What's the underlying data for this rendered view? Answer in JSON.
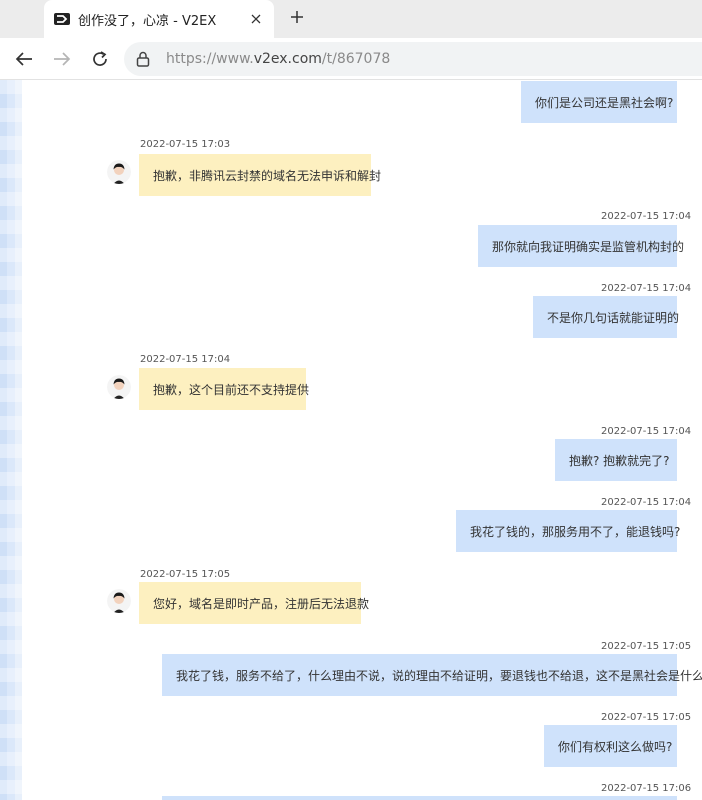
{
  "browser": {
    "tab_title": "创作没了，心凉 - V2EX",
    "url_prefix": "https://www.",
    "url_domain": "v2ex.com",
    "url_path": "/t/867078"
  },
  "chat": {
    "colors": {
      "user_bubble": "#cfe2fb",
      "service_bubble": "#fdf0c0"
    },
    "messages": [
      {
        "side": "right",
        "time": "",
        "text": "你们是公司还是黑社会啊?"
      },
      {
        "side": "left",
        "time": "2022-07-15 17:03",
        "text": "抱歉，非腾讯云封禁的域名无法申诉和解封"
      },
      {
        "side": "right",
        "time": "2022-07-15 17:04",
        "text": "那你就向我证明确实是监管机构封的"
      },
      {
        "side": "right",
        "time": "2022-07-15 17:04",
        "text": "不是你几句话就能证明的"
      },
      {
        "side": "left",
        "time": "2022-07-15 17:04",
        "text": "抱歉，这个目前还不支持提供"
      },
      {
        "side": "right",
        "time": "2022-07-15 17:04",
        "text": "抱歉? 抱歉就完了?"
      },
      {
        "side": "right",
        "time": "2022-07-15 17:04",
        "text": "我花了钱的，那服务用不了，能退钱吗?"
      },
      {
        "side": "left",
        "time": "2022-07-15 17:05",
        "text": "您好，域名是即时产品，注册后无法退款"
      },
      {
        "side": "right",
        "time": "2022-07-15 17:05",
        "text": "我花了钱，服务不给了，什么理由不说，说的理由不给证明，要退钱也不给退，这不是黑社会是什么?"
      },
      {
        "side": "right",
        "time": "2022-07-15 17:05",
        "text": "你们有权利这么做吗?"
      },
      {
        "side": "right",
        "time": "2022-07-15 17:06",
        "text": ""
      }
    ]
  }
}
